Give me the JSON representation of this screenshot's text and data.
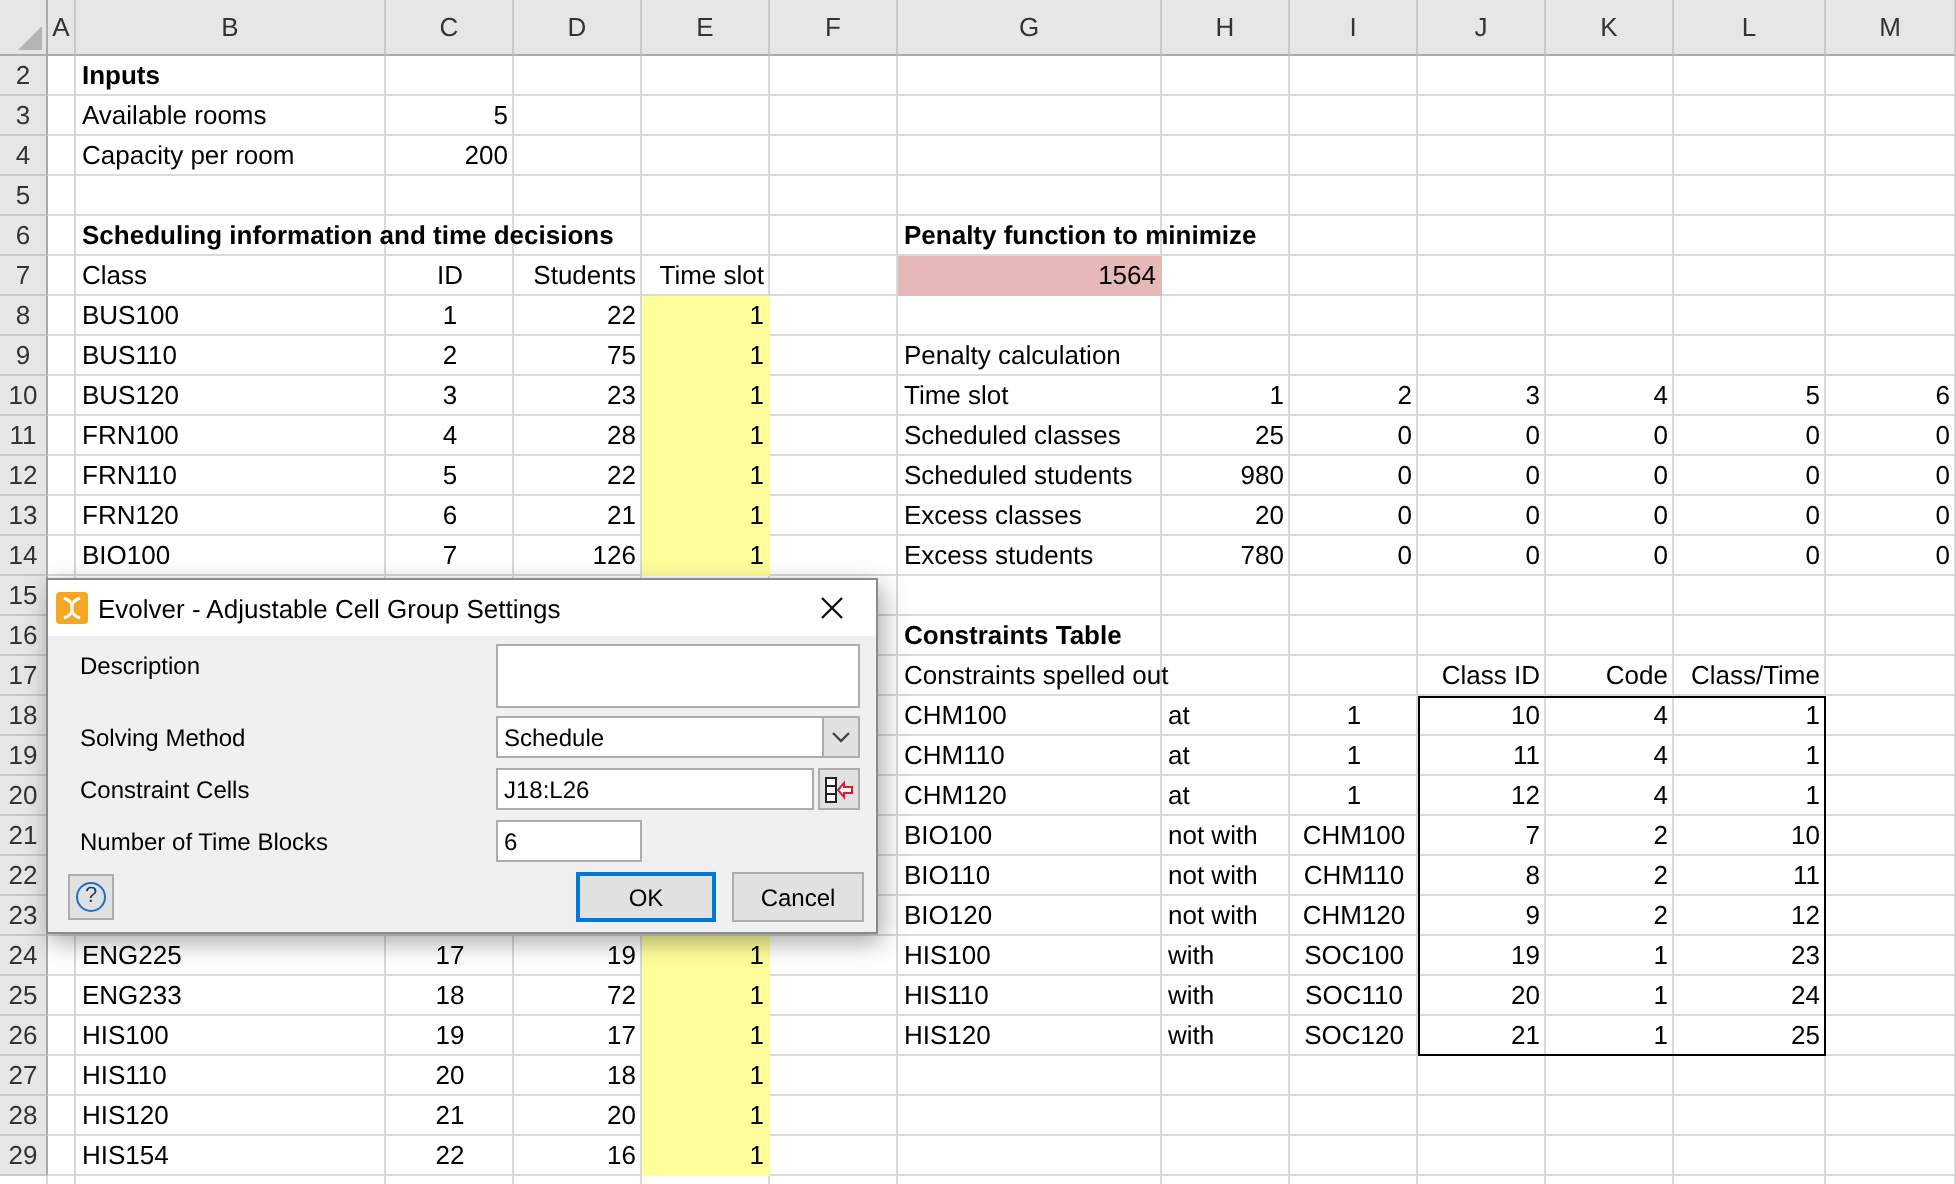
{
  "column_headers": [
    "A",
    "B",
    "C",
    "D",
    "E",
    "F",
    "G",
    "H",
    "I",
    "J",
    "K",
    "L",
    "M"
  ],
  "row_headers": [
    "2",
    "3",
    "4",
    "5",
    "6",
    "7",
    "8",
    "9",
    "10",
    "11",
    "12",
    "13",
    "14",
    "15",
    "16",
    "17",
    "18",
    "19",
    "20",
    "21",
    "22",
    "23",
    "24",
    "25",
    "26",
    "27",
    "28",
    "29"
  ],
  "inputs": {
    "title": "Inputs",
    "rows": [
      {
        "label": "Available rooms",
        "value": "5"
      },
      {
        "label": "Capacity per room",
        "value": "200"
      }
    ]
  },
  "schedule": {
    "title": "Scheduling information and time decisions",
    "columns": [
      "Class",
      "ID",
      "Students",
      "Time slot"
    ],
    "rows_above_dialog": [
      {
        "class": "BUS100",
        "id": "1",
        "students": "22",
        "time_slot": "1"
      },
      {
        "class": "BUS110",
        "id": "2",
        "students": "75",
        "time_slot": "1"
      },
      {
        "class": "BUS120",
        "id": "3",
        "students": "23",
        "time_slot": "1"
      },
      {
        "class": "FRN100",
        "id": "4",
        "students": "28",
        "time_slot": "1"
      },
      {
        "class": "FRN110",
        "id": "5",
        "students": "22",
        "time_slot": "1"
      },
      {
        "class": "FRN120",
        "id": "6",
        "students": "21",
        "time_slot": "1"
      },
      {
        "class": "BIO100",
        "id": "7",
        "students": "126",
        "time_slot": "1"
      }
    ],
    "rows_below_dialog": [
      {
        "class": "ENG225",
        "id": "17",
        "students": "19",
        "time_slot": "1"
      },
      {
        "class": "ENG233",
        "id": "18",
        "students": "72",
        "time_slot": "1"
      },
      {
        "class": "HIS100",
        "id": "19",
        "students": "17",
        "time_slot": "1"
      },
      {
        "class": "HIS110",
        "id": "20",
        "students": "18",
        "time_slot": "1"
      },
      {
        "class": "HIS120",
        "id": "21",
        "students": "20",
        "time_slot": "1"
      },
      {
        "class": "HIS154",
        "id": "22",
        "students": "16",
        "time_slot": "1"
      }
    ]
  },
  "penalty": {
    "title": "Penalty function to minimize",
    "value": "1564"
  },
  "penalty_calculation": {
    "title": "Penalty calculation",
    "rows": [
      {
        "label": "Time slot",
        "values": [
          "1",
          "2",
          "3",
          "4",
          "5",
          "6"
        ]
      },
      {
        "label": "Scheduled classes",
        "values": [
          "25",
          "0",
          "0",
          "0",
          "0",
          "0"
        ]
      },
      {
        "label": "Scheduled students",
        "values": [
          "980",
          "0",
          "0",
          "0",
          "0",
          "0"
        ]
      },
      {
        "label": "Excess classes",
        "values": [
          "20",
          "0",
          "0",
          "0",
          "0",
          "0"
        ]
      },
      {
        "label": "Excess students",
        "values": [
          "780",
          "0",
          "0",
          "0",
          "0",
          "0"
        ]
      }
    ]
  },
  "constraints": {
    "title": "Constraints Table",
    "subtitle": "Constraints spelled out",
    "columns": [
      "Class ID",
      "Code",
      "Class/Time"
    ],
    "rows": [
      {
        "class": "CHM100",
        "relation": "at",
        "target": "1",
        "class_id": "10",
        "code": "4",
        "class_time": "1"
      },
      {
        "class": "CHM110",
        "relation": "at",
        "target": "1",
        "class_id": "11",
        "code": "4",
        "class_time": "1"
      },
      {
        "class": "CHM120",
        "relation": "at",
        "target": "1",
        "class_id": "12",
        "code": "4",
        "class_time": "1"
      },
      {
        "class": "BIO100",
        "relation": "not with",
        "target": "CHM100",
        "class_id": "7",
        "code": "2",
        "class_time": "10"
      },
      {
        "class": "BIO110",
        "relation": "not with",
        "target": "CHM110",
        "class_id": "8",
        "code": "2",
        "class_time": "11"
      },
      {
        "class": "BIO120",
        "relation": "not with",
        "target": "CHM120",
        "class_id": "9",
        "code": "2",
        "class_time": "12"
      },
      {
        "class": "HIS100",
        "relation": "with",
        "target": "SOC100",
        "class_id": "19",
        "code": "1",
        "class_time": "23"
      },
      {
        "class": "HIS110",
        "relation": "with",
        "target": "SOC110",
        "class_id": "20",
        "code": "1",
        "class_time": "24"
      },
      {
        "class": "HIS120",
        "relation": "with",
        "target": "SOC120",
        "class_id": "21",
        "code": "1",
        "class_time": "25"
      }
    ]
  },
  "dialog": {
    "title": "Evolver - Adjustable Cell Group Settings",
    "fields": [
      {
        "kind": "textarea",
        "label": "Description"
      },
      {
        "kind": "dropdown",
        "label": "Solving Method",
        "value": "Schedule"
      },
      {
        "kind": "range",
        "label": "Constraint Cells",
        "value": "J18:L26"
      },
      {
        "kind": "number",
        "label": "Number of Time Blocks",
        "value": "6"
      }
    ],
    "buttons": [
      {
        "kind": "help",
        "label": "?"
      },
      {
        "kind": "ok",
        "label": "OK",
        "default": true
      },
      {
        "kind": "cancel",
        "label": "Cancel",
        "default": false
      }
    ]
  }
}
